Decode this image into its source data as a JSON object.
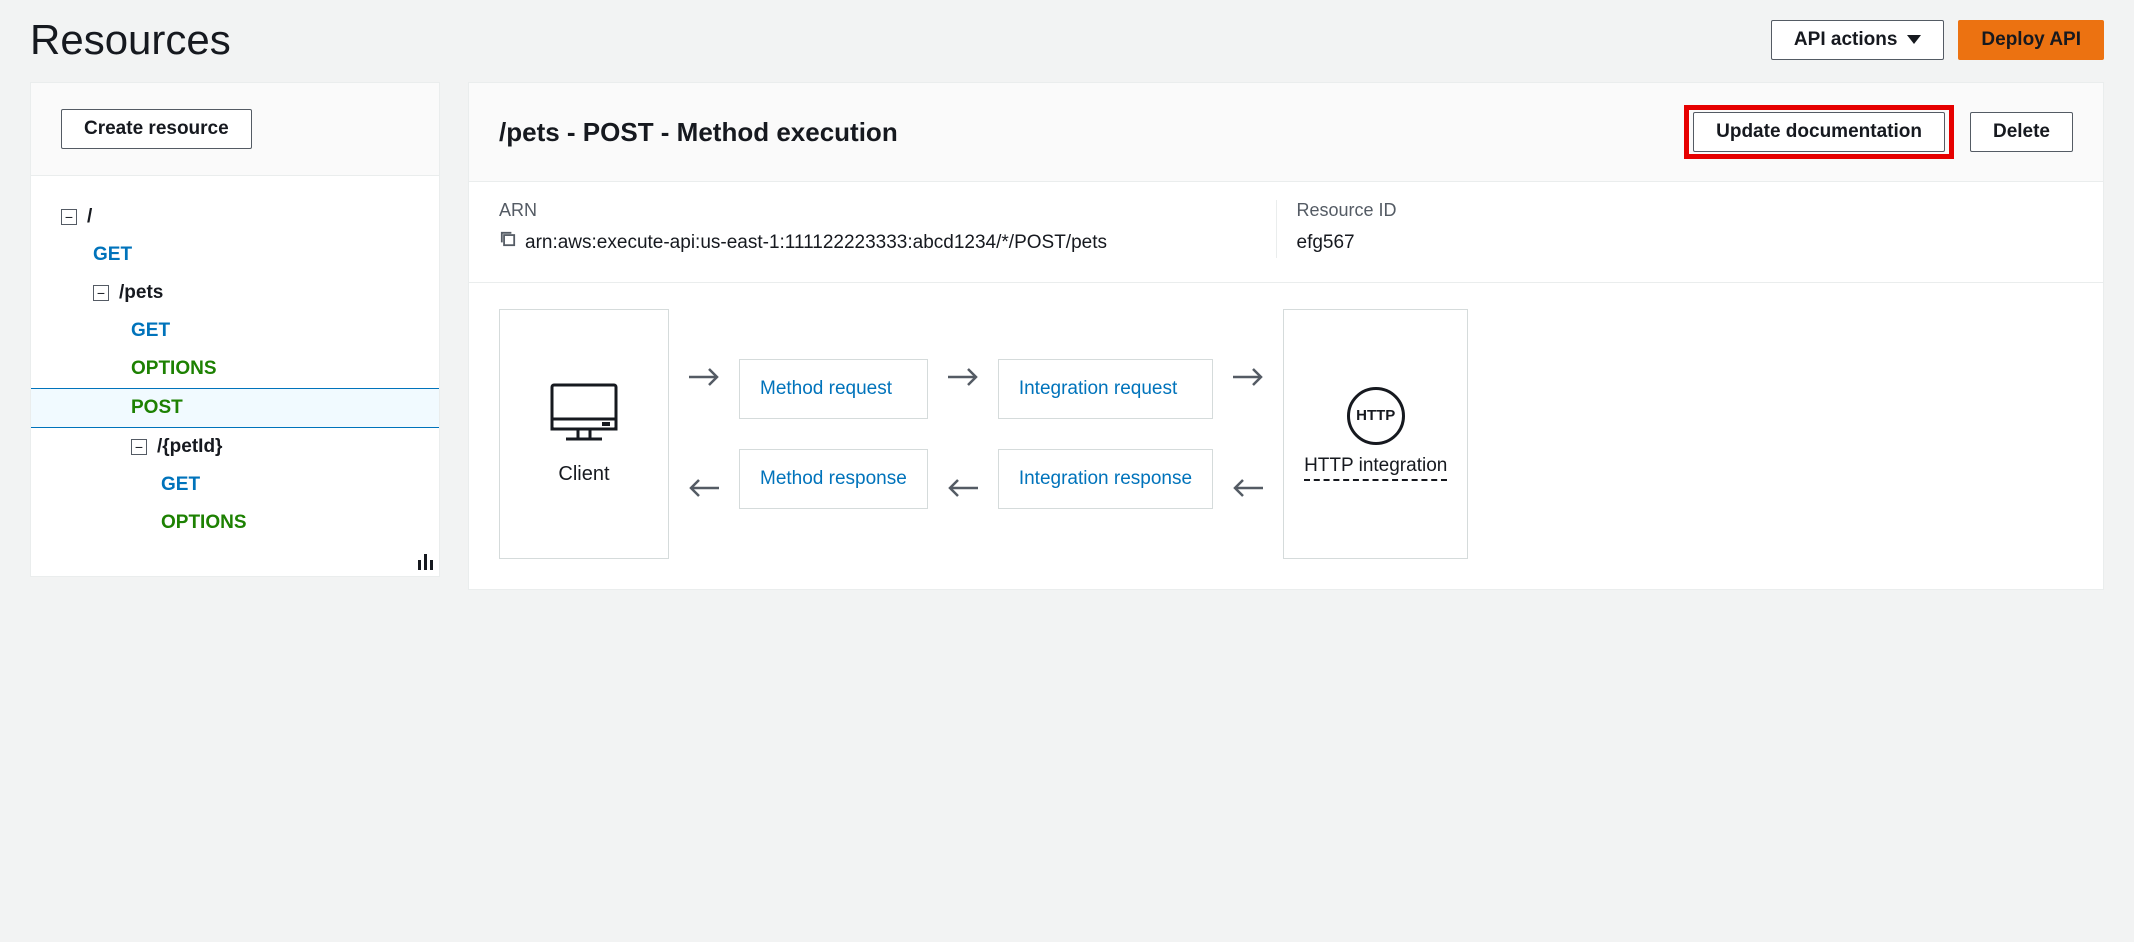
{
  "header": {
    "title": "Resources",
    "api_actions_label": "API actions",
    "deploy_label": "Deploy API"
  },
  "sidebar": {
    "create_resource_label": "Create resource",
    "tree": {
      "root": "/",
      "root_methods": [
        "GET"
      ],
      "pets": {
        "label": "/pets",
        "methods": [
          "GET",
          "OPTIONS",
          "POST"
        ],
        "selected": "POST",
        "petId": {
          "label": "/{petId}",
          "methods": [
            "GET",
            "OPTIONS"
          ]
        }
      }
    }
  },
  "main": {
    "title": "/pets - POST - Method execution",
    "update_doc_label": "Update documentation",
    "delete_label": "Delete",
    "arn_label": "ARN",
    "arn_value": "arn:aws:execute-api:us-east-1:111122223333:abcd1234/*/POST/pets",
    "resource_id_label": "Resource ID",
    "resource_id_value": "efg567",
    "flow": {
      "client_label": "Client",
      "method_request": "Method request",
      "integration_request": "Integration request",
      "http_circle": "HTTP",
      "http_label": "HTTP integration",
      "integration_response": "Integration response",
      "method_response": "Method response"
    }
  }
}
